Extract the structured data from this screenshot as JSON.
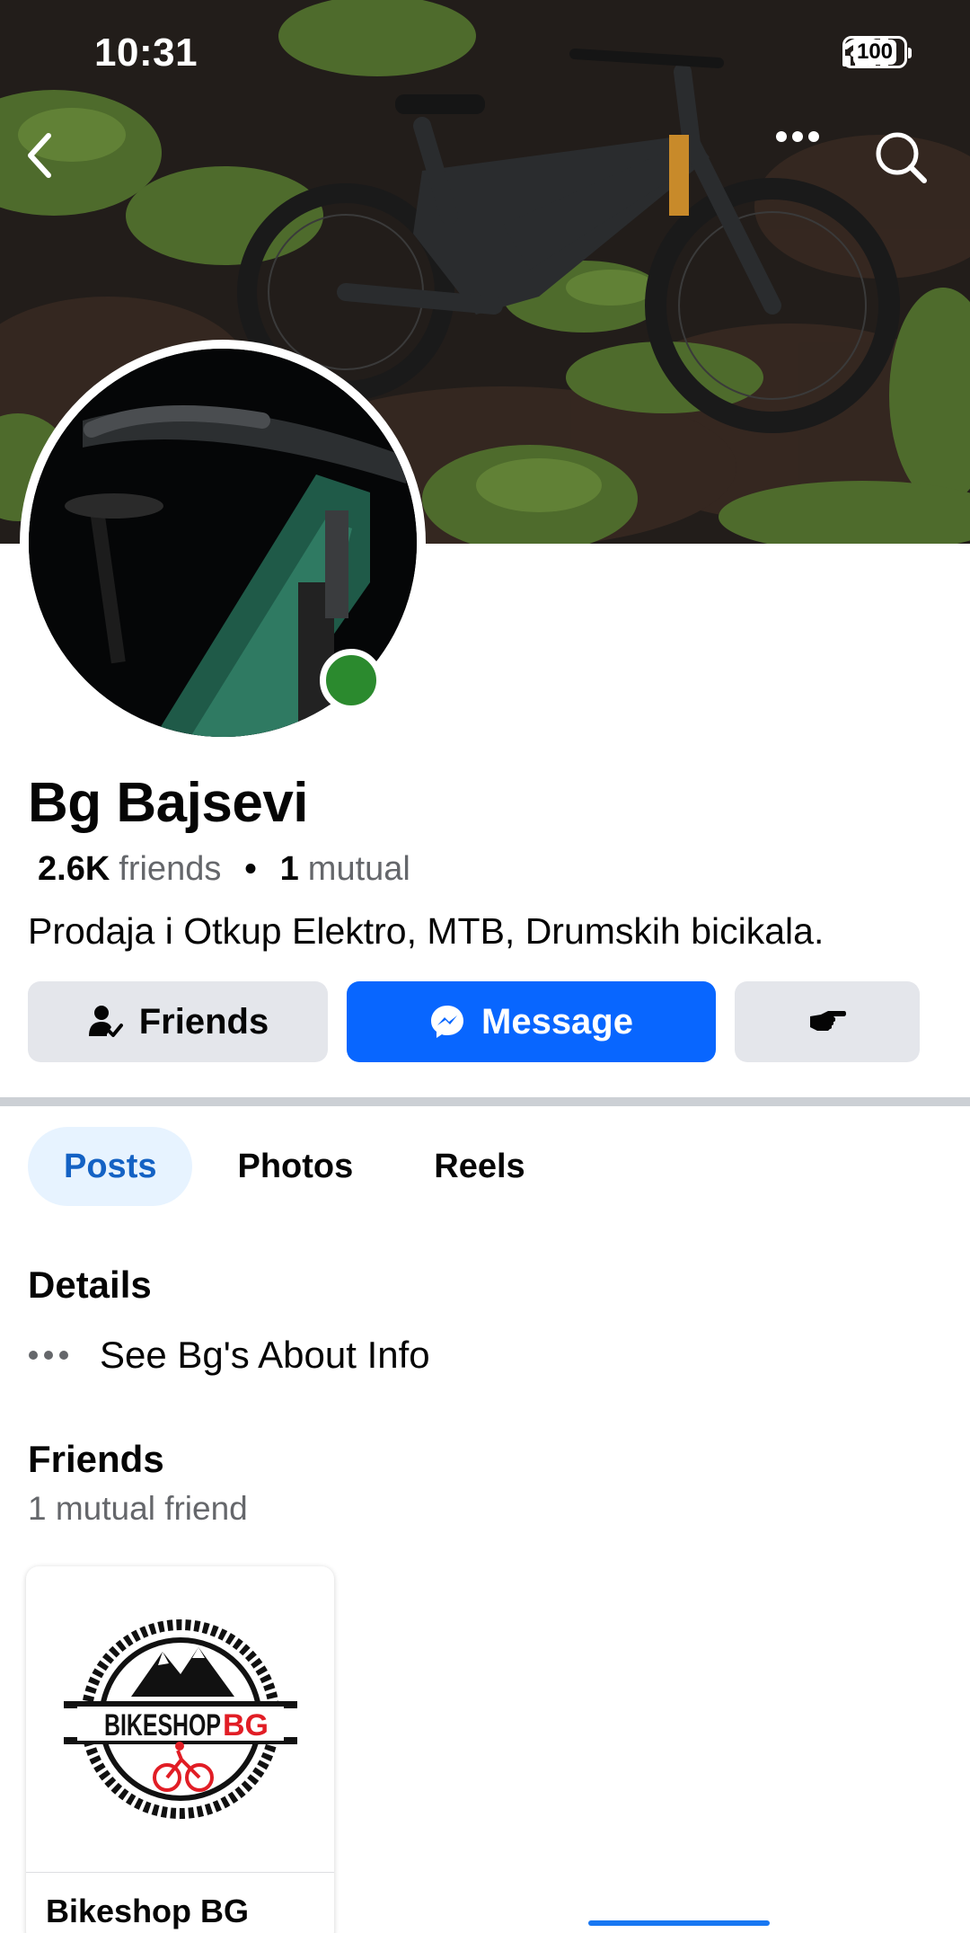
{
  "status_bar": {
    "time": "10:31",
    "battery": "100"
  },
  "cover": {
    "back_icon": "chevron-left-icon",
    "more_icon": "ellipsis-icon",
    "search_icon": "search-icon"
  },
  "profile": {
    "name": "Bg Bajsevi",
    "friends_count": "2.6K",
    "friends_label": "friends",
    "separator": "•",
    "mutual_count": "1",
    "mutual_label": "mutual",
    "bio": "Prodaja i Otkup Elektro, MTB, Drumskih bicikala.",
    "online_color": "#2b8a2e"
  },
  "actions": {
    "friends_label": "Friends",
    "message_label": "Message",
    "message_color": "#0866ff"
  },
  "tabs": [
    {
      "label": "Posts",
      "active": true
    },
    {
      "label": "Photos",
      "active": false
    },
    {
      "label": "Reels",
      "active": false
    }
  ],
  "details": {
    "title": "Details",
    "about_text": "See Bg's About Info"
  },
  "friends_section": {
    "title": "Friends",
    "subtitle": "1 mutual friend",
    "cards": [
      {
        "name": "Bikeshop BG",
        "logo_text_black": "BIKESHOP",
        "logo_text_red": "BG"
      }
    ]
  }
}
